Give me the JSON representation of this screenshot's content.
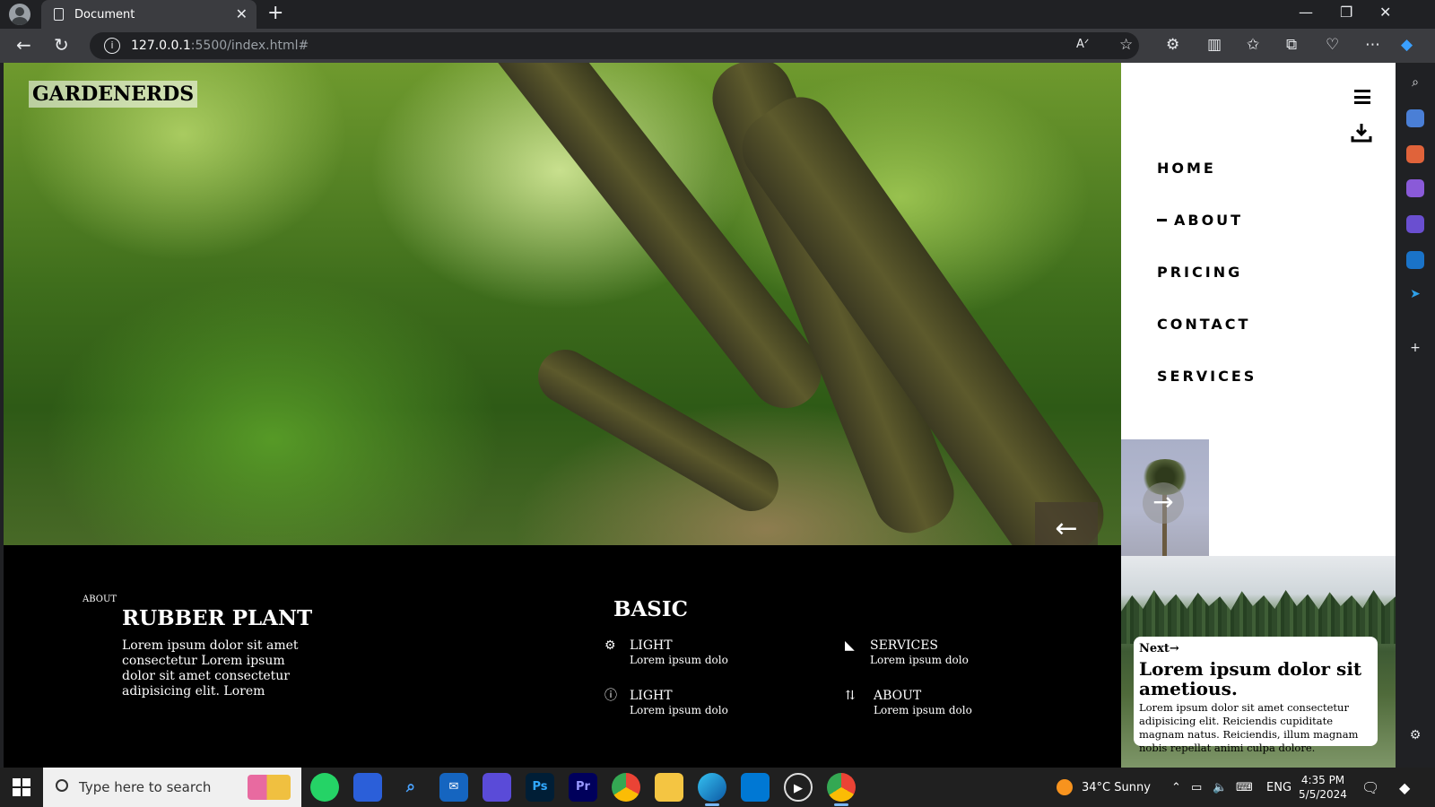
{
  "browser": {
    "tab_title": "Document",
    "url_host": "127.0.0.1",
    "url_path": ":5500/index.html#"
  },
  "site": {
    "logo": "GARDENERDS",
    "nav": [
      "HOME",
      "ABOUT",
      "PRICING",
      "CONTACT",
      "SERVICES"
    ],
    "active_nav": "ABOUT",
    "prev_arrow": "←",
    "next_arrow": "→",
    "about": {
      "tag": "ABOUT",
      "title": "RUBBER PLANT",
      "text": "Lorem ipsum dolor sit amet consectetur Lorem ipsum dolor sit amet consectetur adipisicing elit. Lorem"
    },
    "basic": {
      "title": "BASIC",
      "features": [
        {
          "title": "LIGHT",
          "sub": "Lorem ipsum dolo",
          "icon": "gear-icon"
        },
        {
          "title": "SERVICES",
          "sub": "Lorem ipsum dolo",
          "icon": "send-icon"
        },
        {
          "title": "LIGHT",
          "sub": "Lorem ipsum dolo",
          "icon": "help-icon"
        },
        {
          "title": "ABOUT",
          "sub": "Lorem ipsum dolo",
          "icon": "merge-icon"
        }
      ]
    },
    "card": {
      "next_label": "Next",
      "title": "Lorem ipsum dolor sit ametious.",
      "text": "Lorem ipsum dolor sit amet consectetur adipisicing elit. Reiciendis cupiditate magnam natus. Reiciendis, illum magnam nobis repellat animi culpa dolore."
    }
  },
  "taskbar": {
    "search_placeholder": "Type here to search",
    "weather": "34°C  Sunny",
    "language": "ENG",
    "time": "4:35 PM",
    "date": "5/5/2024",
    "apps": [
      "whatsapp",
      "store",
      "search",
      "mail",
      "copilot",
      "Ps",
      "Pr",
      "chrome",
      "explorer",
      "edge",
      "vscode",
      "media-player",
      "chrome-profile"
    ]
  }
}
